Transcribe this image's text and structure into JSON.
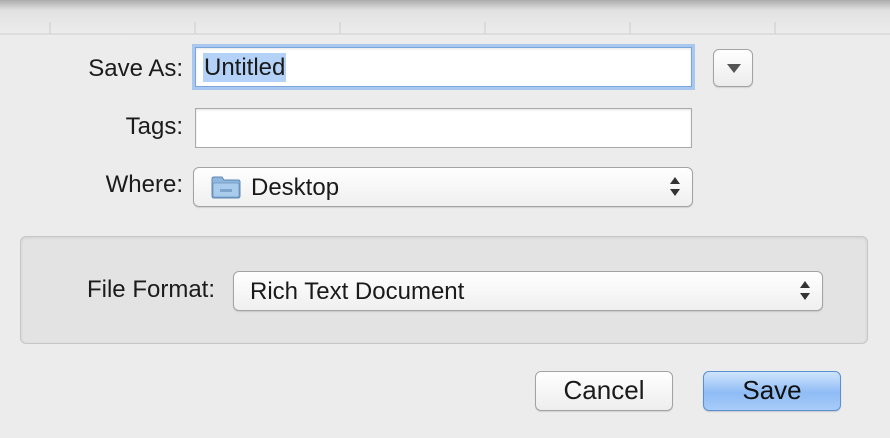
{
  "dialog": {
    "save_as_label": "Save As:",
    "save_as_value": "Untitled",
    "tags_label": "Tags:",
    "tags_value": "",
    "where_label": "Where:",
    "where_value": "Desktop",
    "where_icon": "folder-icon",
    "expand_icon": "disclosure-triangle-icon"
  },
  "options": {
    "file_format_label": "File Format:",
    "file_format_value": "Rich Text Document"
  },
  "buttons": {
    "cancel_label": "Cancel",
    "save_label": "Save"
  },
  "colors": {
    "focus_ring": "#a9c8ef",
    "selection": "#b4d2f7",
    "default_button": "#8fbcf5"
  }
}
